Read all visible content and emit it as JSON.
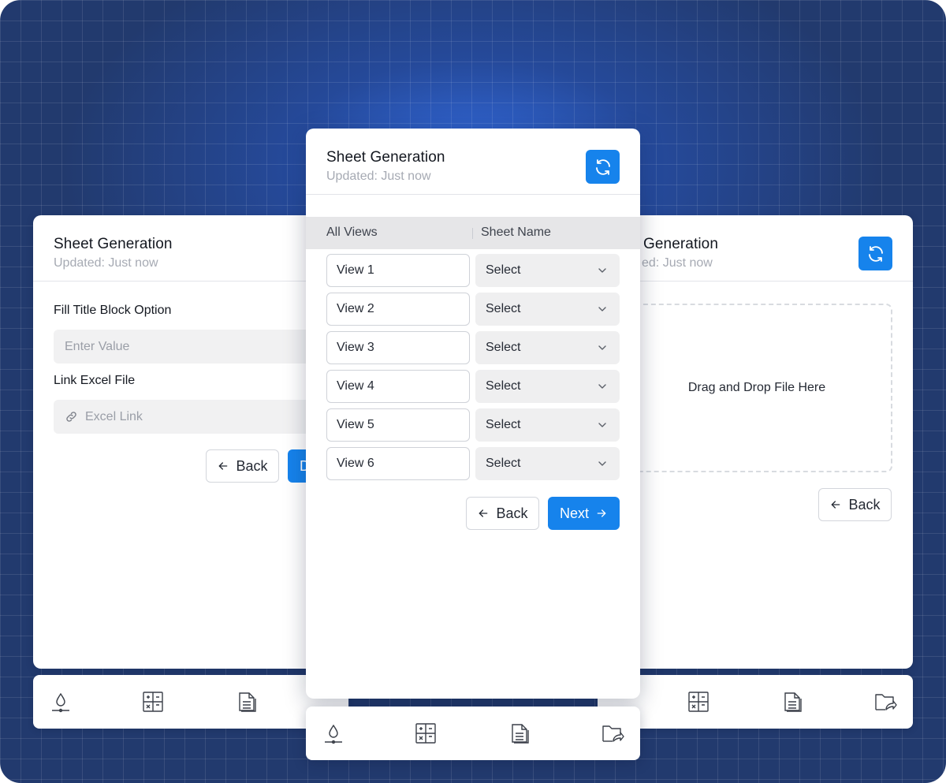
{
  "left_card": {
    "title": "Sheet Generation",
    "subtitle": "Updated: Just now",
    "fill_label": "Fill Title Block Option",
    "fill_placeholder": "Enter Value",
    "excel_label": "Link Excel File",
    "excel_placeholder": "Excel Link",
    "back_label": "Back",
    "primary_label_partial": "D"
  },
  "center_card": {
    "title": "Sheet Generation",
    "subtitle": "Updated: Just now",
    "columns": [
      "All Views",
      "Sheet Name"
    ],
    "rows": [
      {
        "view": "View 1",
        "sheet": "Select"
      },
      {
        "view": "View 2",
        "sheet": "Select"
      },
      {
        "view": "View 3",
        "sheet": "Select"
      },
      {
        "view": "View 4",
        "sheet": "Select"
      },
      {
        "view": "View 5",
        "sheet": "Select"
      },
      {
        "view": "View 6",
        "sheet": "Select"
      }
    ],
    "back_label": "Back",
    "next_label": "Next"
  },
  "right_card": {
    "title_partial": "Generation",
    "subtitle_partial": "ed: Just now",
    "dropzone_text": "Drag and Drop File Here",
    "back_label": "Back"
  },
  "bottom_nav": [
    "drop-icon",
    "calculator-icon",
    "document-icon",
    "folder-share-icon"
  ],
  "colors": {
    "accent": "#1683ec",
    "background": "#223a6e",
    "input_bg": "#f1f1f2"
  }
}
